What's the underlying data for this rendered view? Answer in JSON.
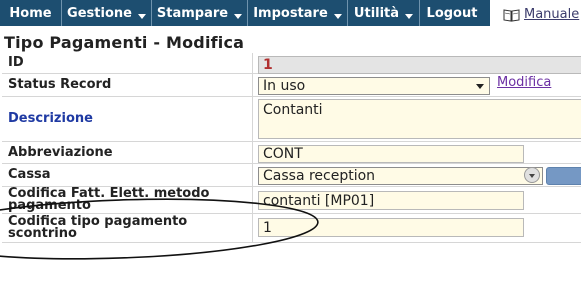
{
  "menu": {
    "home": "Home",
    "gestione": "Gestione",
    "stampare": "Stampare",
    "impostare": "Impostare",
    "utilita": "Utilità",
    "logout": "Logout"
  },
  "manuale": {
    "label": "Manuale",
    "icon": "book-icon"
  },
  "page_title": "Tipo Pagamenti - Modifica",
  "form": {
    "id": {
      "label": "ID",
      "value": "1"
    },
    "status": {
      "label": "Status Record",
      "value": "In uso",
      "link": "Modifica"
    },
    "descrizione": {
      "label": "Descrizione",
      "value": "Contanti"
    },
    "abbreviazione": {
      "label": "Abbreviazione",
      "value": "CONT"
    },
    "cassa": {
      "label": "Cassa",
      "value": "Cassa reception"
    },
    "fatt": {
      "label": "Codifica Fatt. Elett. metodo pagamento",
      "value": "contanti [MP01]"
    },
    "scontrino": {
      "label": "Codifica tipo pagamento scontrino",
      "value": "1"
    }
  },
  "colors": {
    "menubar": "#1d4e70",
    "field_bg": "#fffbe6",
    "annotation": "#111111"
  }
}
